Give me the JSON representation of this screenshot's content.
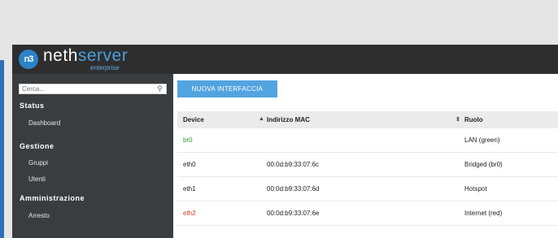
{
  "app": {
    "logo_mark": "n3",
    "logo_word": "neth",
    "logo_word_accent": "server",
    "logo_sub": "enterprise"
  },
  "sidebar": {
    "search_placeholder": "Cerca...",
    "search_icon": "search-icon",
    "sections": [
      {
        "title": "Status",
        "items": [
          "Dashboard"
        ]
      },
      {
        "title": "Gestione",
        "items": [
          "Gruppi",
          "Utenti"
        ]
      },
      {
        "title": "Amministrazione",
        "items": [
          "Arresto"
        ]
      }
    ]
  },
  "main": {
    "new_button": "NUOVA INTERFACCIA",
    "table": {
      "columns": [
        "Device",
        "Indirizzo MAC",
        "Ruolo"
      ],
      "rows": [
        {
          "device": "br0",
          "mac": "",
          "role": "LAN (green)",
          "color": "green"
        },
        {
          "device": "eth0",
          "mac": "00:0d:b9:33:07:6c",
          "role": "Bridged (br0)",
          "color": "default"
        },
        {
          "device": "eth1",
          "mac": "00:0d:b9:33:07:6d",
          "role": "Hotspot",
          "color": "default"
        },
        {
          "device": "eth2",
          "mac": "00:0d:b9:33:07:6e",
          "role": "Internet (red)",
          "color": "red"
        }
      ]
    }
  },
  "colors": {
    "topbar": "#2e2e2e",
    "sidebar": "#3a3d40",
    "accent_blue": "#52a4e0",
    "green": "#2e9d2e",
    "red": "#cc3a2a"
  }
}
